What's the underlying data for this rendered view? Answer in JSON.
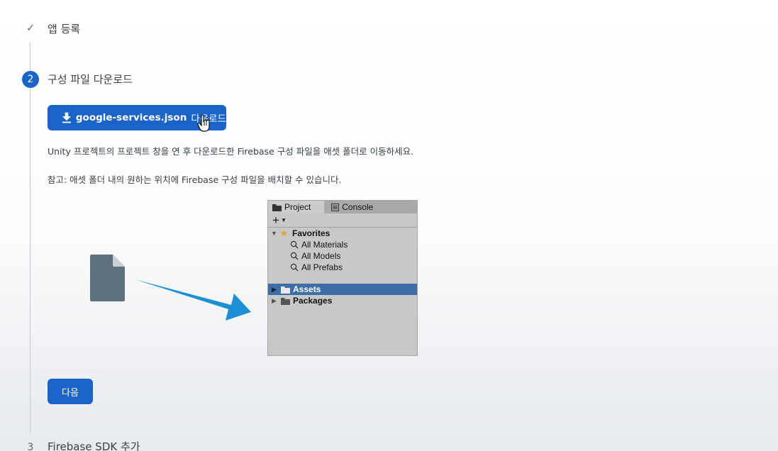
{
  "steps": [
    {
      "marker": "✓",
      "title": "앱 등록",
      "status": "done"
    },
    {
      "marker": "2",
      "title": "구성 파일 다운로드",
      "status": "active"
    },
    {
      "marker": "3",
      "title": "Firebase SDK 추가",
      "status": "pending"
    }
  ],
  "download_button": {
    "icon": "download-icon",
    "filename": "google-services.json",
    "suffix": "다운로드"
  },
  "instructions": [
    "Unity 프로젝트의 프로젝트 창을 연 후 다운로드한 Firebase 구성 파일을 애셋 폴더로 이동하세요.",
    "참고: 애셋 폴더 내의 원하는 위치에 Firebase 구성 파일을 배치할 수 있습니다."
  ],
  "unity_panel": {
    "tabs": [
      "Project",
      "Console"
    ],
    "toolbar_add": "+",
    "favorites": {
      "label": "Favorites",
      "items": [
        "All Materials",
        "All Models",
        "All Prefabs"
      ]
    },
    "folders": [
      {
        "label": "Assets",
        "selected": true
      },
      {
        "label": "Packages",
        "selected": false
      }
    ]
  },
  "next_button": {
    "label": "다음"
  },
  "colors": {
    "primary": "#1a63c8",
    "selection": "#3e6ea8",
    "arrow": "#1e8fd5",
    "file": "#5b6f7c"
  }
}
